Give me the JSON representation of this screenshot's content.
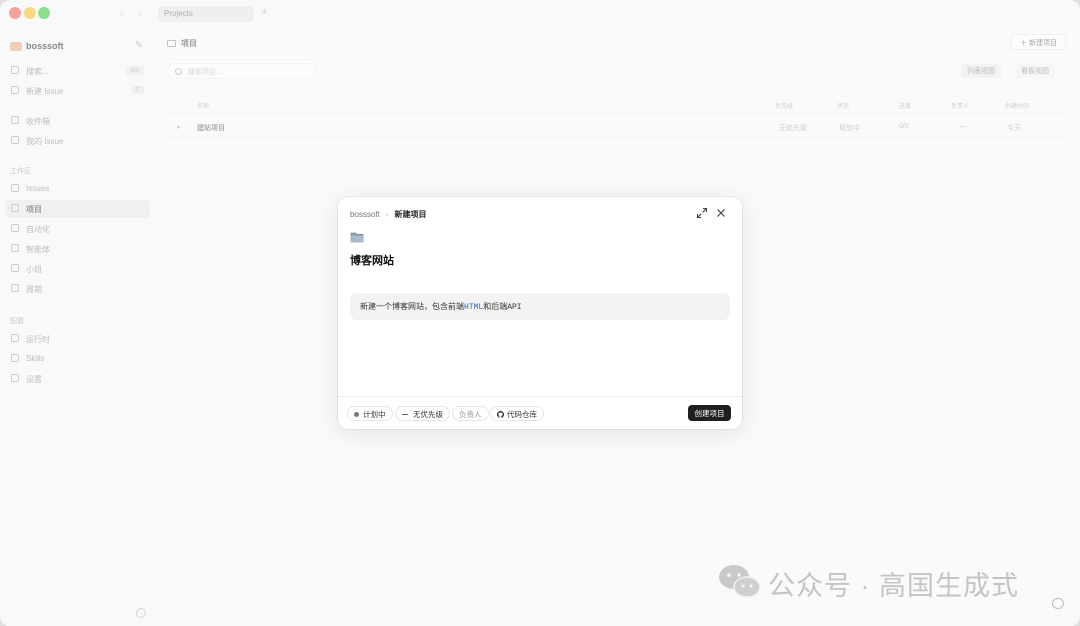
{
  "window": {
    "tab_label": "Projects"
  },
  "sidebar": {
    "workspace_name": "bosssoft",
    "top_items": [
      {
        "label": "搜索...",
        "shortcut": "⌘K"
      },
      {
        "label": "新建 Issue",
        "shortcut": "C"
      }
    ],
    "personal_items": [
      {
        "label": "收件箱"
      },
      {
        "label": "我的 Issue"
      }
    ],
    "workspace_section": "工作区",
    "workspace_items": [
      {
        "label": "Issues"
      },
      {
        "label": "项目"
      },
      {
        "label": "自动化"
      },
      {
        "label": "智能体"
      },
      {
        "label": "小组"
      },
      {
        "label": "周期"
      }
    ],
    "config_section": "配置",
    "config_items": [
      {
        "label": "运行时"
      },
      {
        "label": "Skills"
      },
      {
        "label": "设置"
      }
    ]
  },
  "main": {
    "crumb": "项目",
    "new_project_btn": "新建项目",
    "search_placeholder": "搜索项目...",
    "view_btns": [
      "列表视图",
      "看板视图"
    ],
    "columns": [
      "名称",
      "优先级",
      "状态",
      "进度",
      "负责人",
      "创建时间"
    ],
    "rows": [
      {
        "name": "建站项目",
        "priority": "无优先级",
        "status": "规划中",
        "progress": "0/0",
        "lead": "—",
        "created": "今天"
      }
    ]
  },
  "modal": {
    "crumb_workspace": "bosssoft",
    "crumb_separator": "›",
    "crumb_current": "新建项目",
    "title": "博客网站",
    "description_before": "新建一个博客网站，包含前端",
    "description_code": "HTML",
    "description_middle": "和后端",
    "description_after": "API",
    "footer": {
      "status": "计划中",
      "priority": "无优先级",
      "lead": "负责人",
      "repo": "代码仓库",
      "create_button": "创建项目"
    }
  },
  "watermark": {
    "text": "公众号 · 高国生成式"
  }
}
